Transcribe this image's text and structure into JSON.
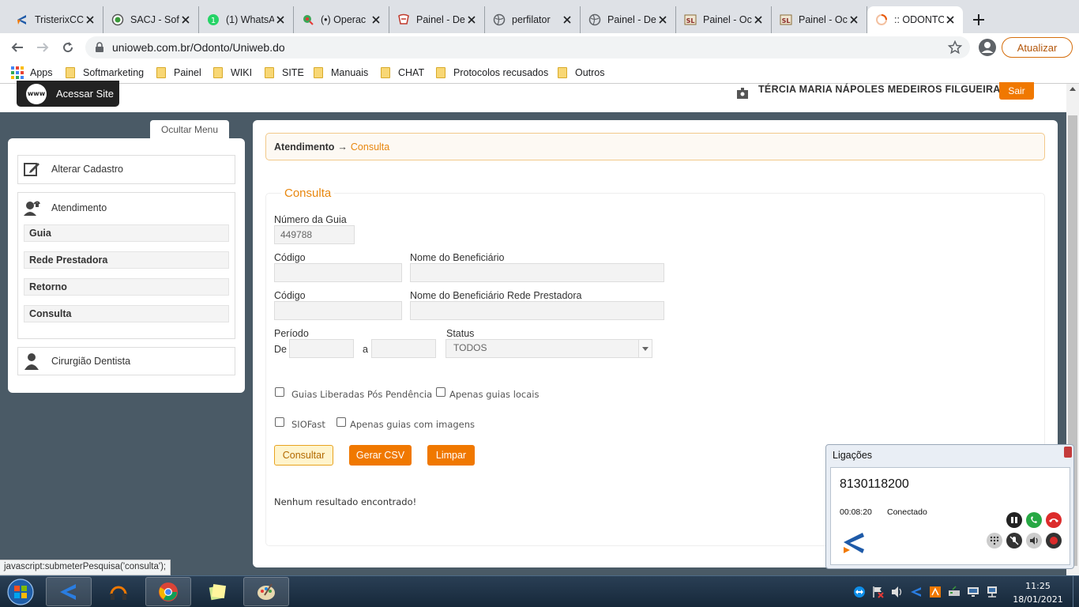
{
  "browser": {
    "tabs": [
      {
        "title": "TristerixCC",
        "icon": "tristerix-icon"
      },
      {
        "title": "SACJ - Soft",
        "icon": "globe-green-icon"
      },
      {
        "title": "(1) WhatsA",
        "icon": "whatsapp-icon"
      },
      {
        "title": "(•) Operac",
        "icon": "map-pin-icon"
      },
      {
        "title": "Painel - De",
        "icon": "painel-red-icon"
      },
      {
        "title": "perfilator",
        "icon": "globe-icon"
      },
      {
        "title": "Painel - De",
        "icon": "globe-icon"
      },
      {
        "title": "Painel - Oc",
        "icon": "sl-icon"
      },
      {
        "title": "Painel - Oc",
        "icon": "sl-icon"
      },
      {
        "title": ":: ODONTO",
        "icon": "loading-icon",
        "active": true
      }
    ],
    "url": "unioweb.com.br/Odonto/Uniweb.do",
    "update_label": "Atualizar",
    "bookmarks": [
      "Apps",
      "Softmarketing",
      "Painel",
      "WIKI",
      "SITE",
      "Manuais",
      "CHAT",
      "Protocolos recusados",
      "Outros"
    ]
  },
  "header": {
    "site_button": "Acessar Site",
    "www_text": "www",
    "user_name": "TÉRCIA MARIA NÁPOLES MEDEIROS FILGUEIRA",
    "logout_label": "Sair"
  },
  "sidebar": {
    "hide_menu": "Ocultar Menu",
    "alterar": "Alterar Cadastro",
    "atendimento": "Atendimento",
    "items": [
      "Guia",
      "Rede Prestadora",
      "Retorno",
      "Consulta"
    ],
    "cirurgiao": "Cirurgião Dentista"
  },
  "main": {
    "breadcrumb": {
      "section": "Atendimento",
      "arrow": "→",
      "page": "Consulta"
    },
    "legend": "Consulta",
    "numero_guia_label": "Número da Guia",
    "numero_guia_value": "449788",
    "codigo_label": "Código",
    "nome_benef_label": "Nome do Beneficiário",
    "codigo2_label": "Código",
    "nome_benef_rede_label": "Nome do Beneficiário Rede Prestadora",
    "periodo_label": "Período",
    "de_label": "De",
    "a_label": "a",
    "status_label": "Status",
    "status_value": "TODOS",
    "checkboxes": [
      "Guias Liberadas Pós Pendência",
      "Apenas guias locais",
      "SIOFast",
      "Apenas guias com imagens"
    ],
    "buttons": {
      "consultar": "Consultar",
      "csv": "Gerar CSV",
      "limpar": "Limpar"
    },
    "no_result": "Nenhum resultado encontrado!"
  },
  "status_hint": "javascript:submeterPesquisa('consulta');",
  "call_panel": {
    "title": "Ligações",
    "number": "8130118200",
    "duration": "00:08:20",
    "status": "Conectado"
  },
  "taskbar": {
    "time": "11:25",
    "date": "18/01/2021"
  },
  "colors": {
    "accent_orange": "#f07800",
    "legend_orange": "#e8870f",
    "page_bg": "#4a5a66"
  }
}
